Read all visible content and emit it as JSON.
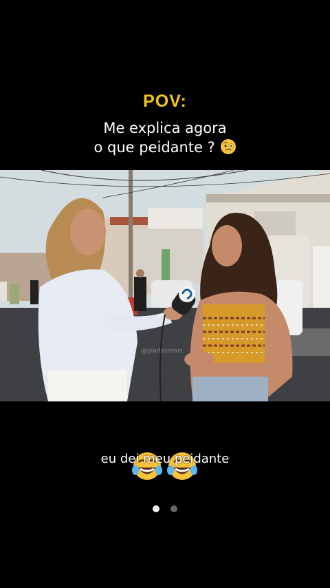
{
  "header": {
    "pov_label": "POV:",
    "question_line1": "Me explica agora",
    "question_line2": "o que peidante ?"
  },
  "video": {
    "watermark": "@piadasreais"
  },
  "caption": {
    "text": "eu dei meu peidante"
  },
  "carousel": {
    "count": 2,
    "active_index": 0
  },
  "colors": {
    "background": "#000000",
    "pov_yellow": "#f5c518"
  }
}
